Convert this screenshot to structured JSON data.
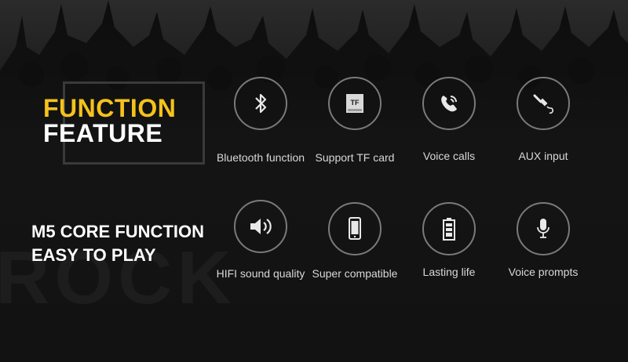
{
  "heading": {
    "line1": "FUNCTION",
    "line2": "FEATURE",
    "accent_color": "#f5c21a"
  },
  "subheading": {
    "line1": "M5 CORE FUNCTION",
    "line2": "EASY TO PLAY"
  },
  "background_word": "ROCK",
  "features_row1": [
    {
      "label": "Bluetooth function",
      "icon": "bluetooth-icon"
    },
    {
      "label": "Support TF card",
      "icon": "tf-card-icon",
      "icon_text": "TF"
    },
    {
      "label": "Voice calls",
      "icon": "phone-call-icon"
    },
    {
      "label": "AUX input",
      "icon": "aux-jack-icon"
    }
  ],
  "features_row2": [
    {
      "label": "HIFI sound quality",
      "icon": "speaker-icon"
    },
    {
      "label": "Super compatible",
      "icon": "smartphone-icon"
    },
    {
      "label": "Lasting life",
      "icon": "battery-icon"
    },
    {
      "label": "Voice prompts",
      "icon": "microphone-icon"
    }
  ]
}
